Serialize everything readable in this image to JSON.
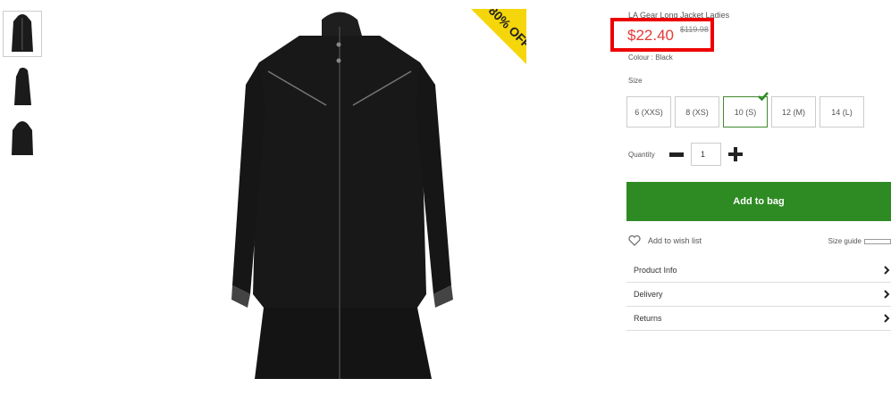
{
  "product": {
    "title": "LA Gear Long Jacket Ladies",
    "price": "$22.40",
    "old_price": "$119.98",
    "colour_label": "Colour : Black",
    "badge_text": "80% OFF"
  },
  "size": {
    "label": "Size",
    "options": [
      "6 (XXS)",
      "8 (XS)",
      "10 (S)",
      "12 (M)",
      "14 (L)"
    ],
    "selected": "10 (S)"
  },
  "quantity": {
    "label": "Quantity",
    "value": "1"
  },
  "actions": {
    "add_to_bag": "Add to bag",
    "wish_list": "Add to wish list",
    "size_guide": "Size guide"
  },
  "accordion": [
    {
      "label": "Product Info"
    },
    {
      "label": "Delivery"
    },
    {
      "label": "Returns"
    }
  ],
  "colors": {
    "accent_green": "#2e8b23",
    "price_red": "#e53935",
    "highlight_red": "#e00000",
    "badge_yellow": "#f5d60a"
  }
}
